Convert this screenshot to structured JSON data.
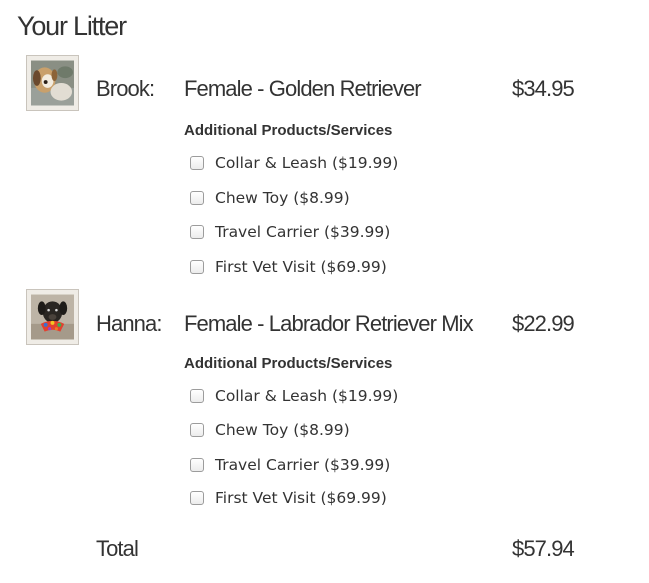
{
  "title": "Your Litter",
  "pets": [
    {
      "name": "Brook:",
      "description": "Female - Golden Retriever",
      "price": "$34.95",
      "addons_heading": "Additional Products/Services",
      "addons": [
        {
          "label": "Collar & Leash ($19.99)",
          "checked": false
        },
        {
          "label": "Chew Toy ($8.99)",
          "checked": false
        },
        {
          "label": "Travel Carrier ($39.99)",
          "checked": false
        },
        {
          "label": "First Vet Visit ($69.99)",
          "checked": false
        }
      ]
    },
    {
      "name": "Hanna:",
      "description": "Female - Labrador Retriever Mix",
      "price": "$22.99",
      "addons_heading": "Additional Products/Services",
      "addons": [
        {
          "label": "Collar & Leash ($19.99)",
          "checked": false
        },
        {
          "label": "Chew Toy ($8.99)",
          "checked": false
        },
        {
          "label": "Travel Carrier ($39.99)",
          "checked": false
        },
        {
          "label": "First Vet Visit ($69.99)",
          "checked": false
        }
      ]
    }
  ],
  "total": {
    "label": "Total",
    "value": "$57.94"
  }
}
